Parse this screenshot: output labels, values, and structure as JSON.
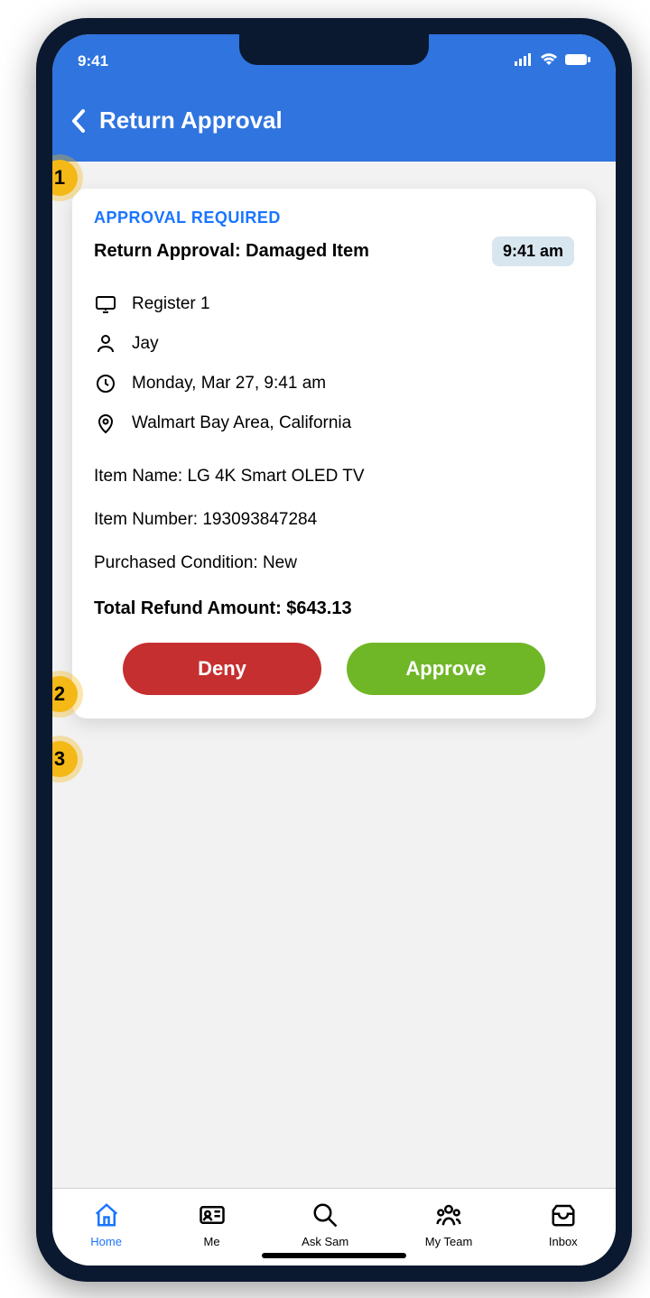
{
  "status_bar": {
    "time": "9:41"
  },
  "header": {
    "title": "Return Approval"
  },
  "callouts": {
    "one": "1",
    "two": "2",
    "three": "3"
  },
  "card": {
    "approval_label": "APPROVAL REQUIRED",
    "title": "Return Approval: Damaged Item",
    "time_label": "9:41 am",
    "register": "Register 1",
    "user": "Jay",
    "when": "Monday, Mar 27, 9:41 am",
    "where": "Walmart Bay Area, California",
    "item_name_line": "Item Name: LG 4K Smart OLED TV",
    "item_number_line": "Item Number: 193093847284",
    "condition_line": "Purchased Condition: New",
    "total_line": "Total Refund Amount: $643.13",
    "deny_label": "Deny",
    "approve_label": "Approve"
  },
  "tabs": {
    "home": "Home",
    "me": "Me",
    "ask_sam": "Ask Sam",
    "my_team": "My Team",
    "inbox": "Inbox"
  }
}
